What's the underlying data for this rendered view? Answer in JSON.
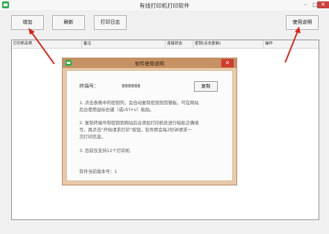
{
  "window": {
    "title": "有线打印机打印软件",
    "minimize": "–",
    "maximize": "□",
    "close": "✕"
  },
  "toolbar": {
    "add": "增加",
    "refresh": "刷新",
    "print_log": "打印日志",
    "usage": "使用说明"
  },
  "table": {
    "columns": [
      "打印机名称",
      "备注",
      "连接状态",
      "密钥(点击复制)",
      "操作"
    ]
  },
  "dialog": {
    "title": "软件使用说明",
    "close": "✕",
    "terminal_label": "终端号：",
    "terminal_value": "888888",
    "copy_button": "复制",
    "p1_l1": "1. 点击表格中的密钥列，会自动复制密钥到剪辑板，可在网站",
    "p1_l2": "后台使用鼠标右键（或ctrl+v）粘贴。",
    "p2_l1": "2. 复制终端号和密钥到网站后台添加打印机处进行粘贴正确填",
    "p2_l2": "写，再点击“开始请求打印”按钮，软件即会每2秒钟请求一",
    "p2_l3": "次打印信息。",
    "p3": "3. 目前仅支持12个打印机",
    "version": "软件当前版本号：1"
  },
  "colors": {
    "arrow": "#e02010",
    "dialog_title": "#c69264",
    "dialog_frame": "#e8c9a8",
    "dialog_close": "#d13a2d"
  }
}
